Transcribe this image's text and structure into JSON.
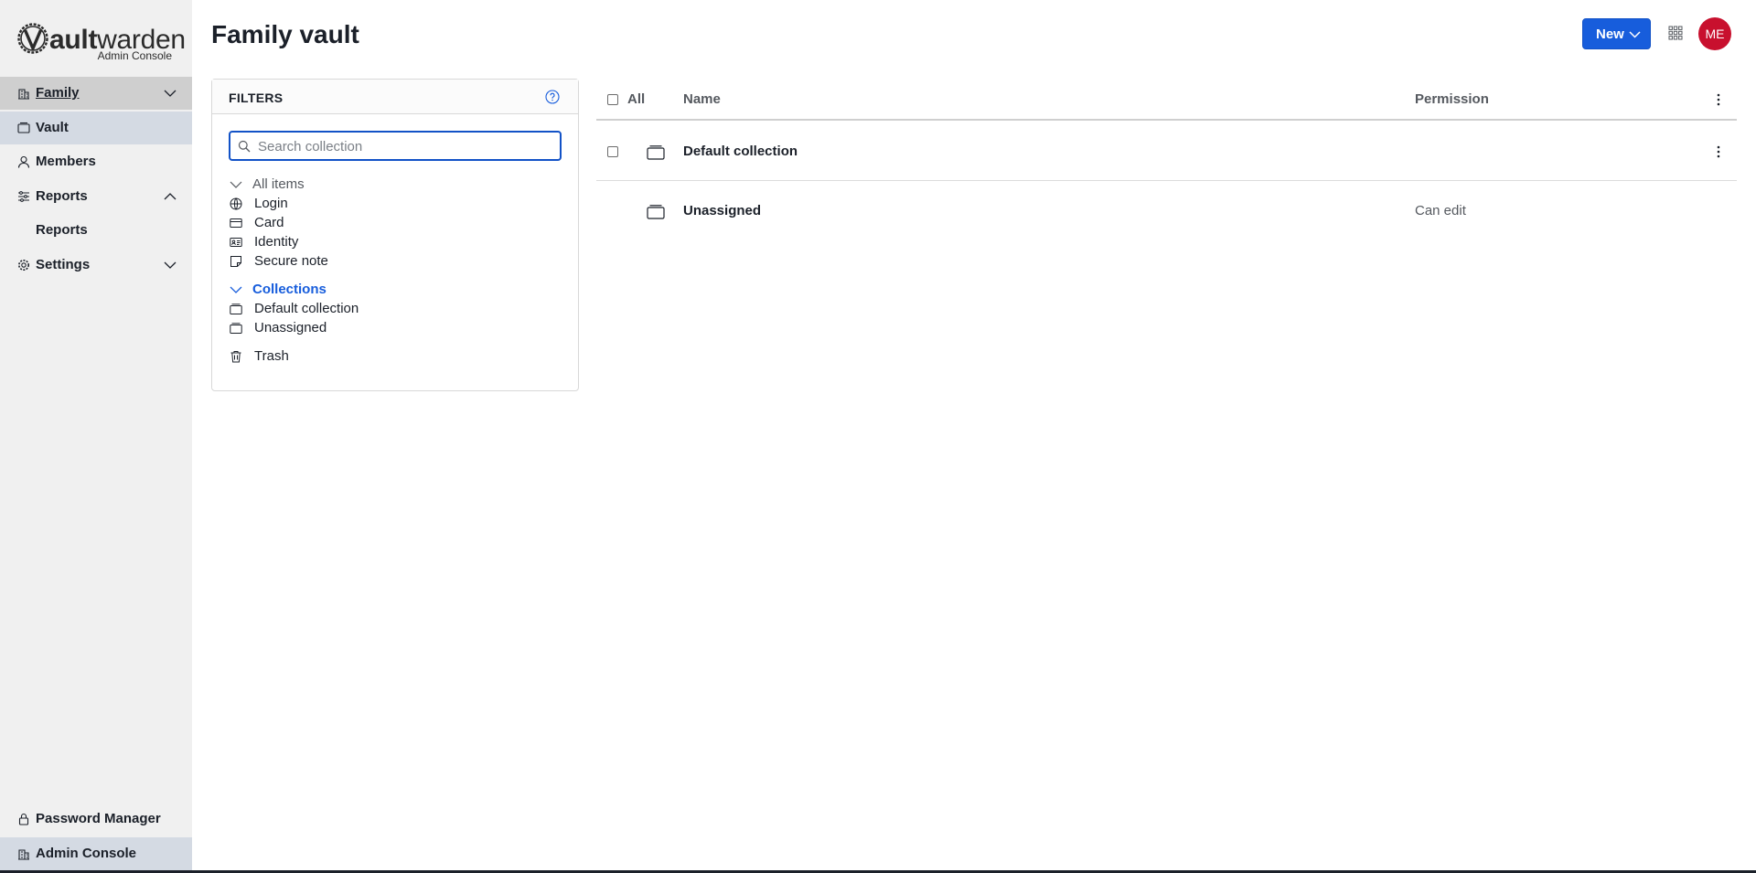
{
  "sidebar": {
    "logo": {
      "word_v": "V",
      "word_bold": "ault",
      "word_light": "warden",
      "subtitle": "Admin Console"
    },
    "org": {
      "label": "Family",
      "icon": "building-icon"
    },
    "items": [
      {
        "label": "Vault",
        "icon": "vault-icon"
      },
      {
        "label": "Members",
        "icon": "user-icon"
      },
      {
        "label": "Reports",
        "icon": "sliders-icon"
      },
      {
        "label": "Reports"
      },
      {
        "label": "Settings",
        "icon": "gear-icon"
      }
    ],
    "footer": [
      {
        "label": "Password Manager",
        "icon": "lock-icon"
      },
      {
        "label": "Admin Console",
        "icon": "building-icon"
      }
    ]
  },
  "header": {
    "title": "Family vault",
    "new_label": "New",
    "avatar_initials": "ME",
    "avatar_color": "#c8102e",
    "accent": "#175ddc"
  },
  "filters": {
    "title": "FILTERS",
    "search": {
      "placeholder": "Search collection",
      "value": ""
    },
    "all_items": "All items",
    "types": [
      {
        "label": "Login",
        "icon": "globe-icon"
      },
      {
        "label": "Card",
        "icon": "credit-card-icon"
      },
      {
        "label": "Identity",
        "icon": "id-card-icon"
      },
      {
        "label": "Secure note",
        "icon": "note-icon"
      }
    ],
    "collections_label": "Collections",
    "collections": [
      {
        "label": "Default collection",
        "icon": "collection-icon"
      },
      {
        "label": "Unassigned",
        "icon": "collection-icon"
      }
    ],
    "trash": "Trash"
  },
  "table": {
    "headers": {
      "all": "All",
      "name": "Name",
      "permission": "Permission"
    },
    "rows": [
      {
        "name": "Default collection",
        "permission": ""
      },
      {
        "name": "Unassigned",
        "permission": "Can edit"
      }
    ]
  }
}
